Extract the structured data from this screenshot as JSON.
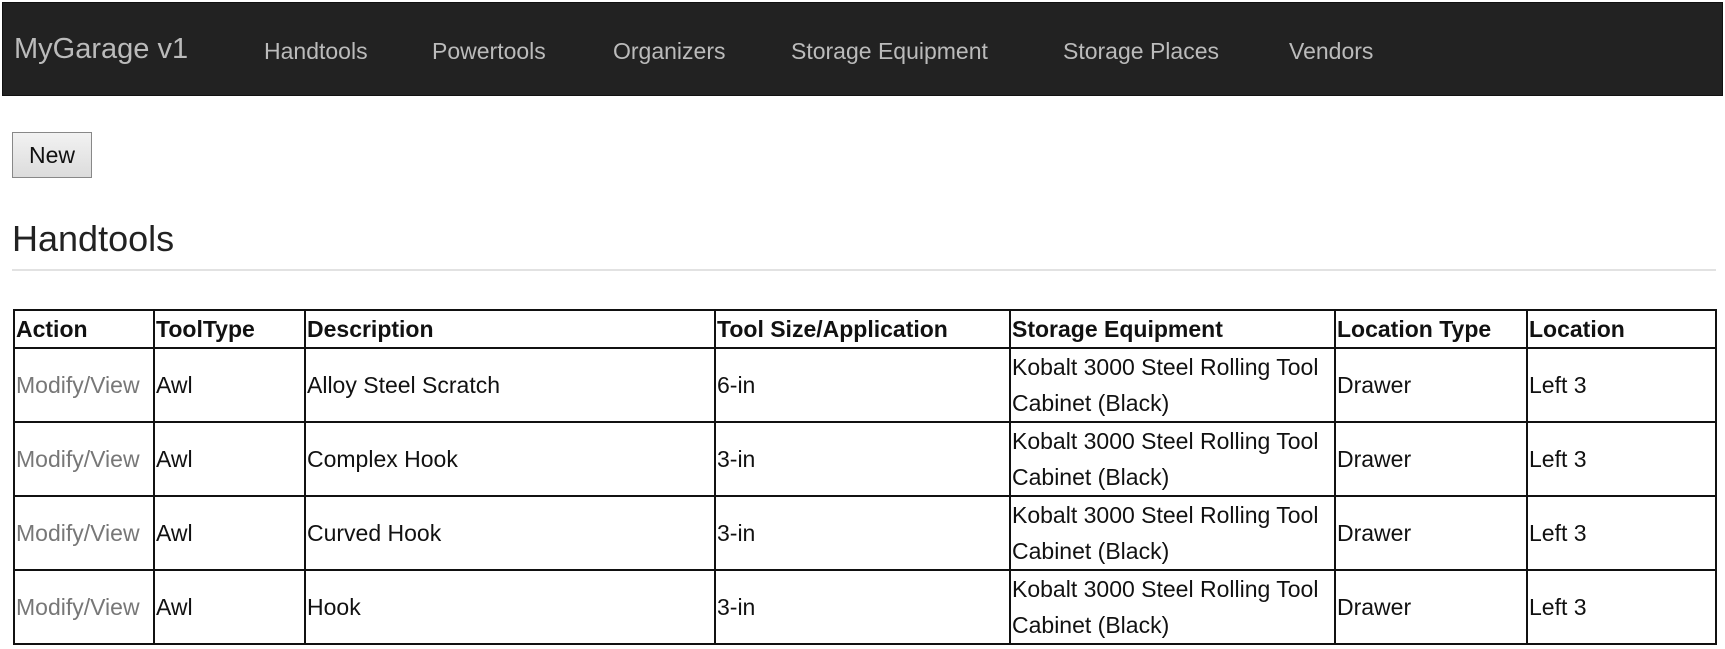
{
  "navbar": {
    "brand": "MyGarage v1",
    "items": [
      "Handtools",
      "Powertools",
      "Organizers",
      "Storage Equipment",
      "Storage Places",
      "Vendors"
    ]
  },
  "new_button": "New",
  "page_title": "Handtools",
  "table": {
    "headers": [
      "Action",
      "ToolType",
      "Description",
      "Tool Size/Application",
      "Storage Equipment",
      "Location Type",
      "Location"
    ],
    "rows": [
      {
        "action": "Modify/View",
        "tooltype": "Awl",
        "description": "Alloy Steel Scratch",
        "size": "6-in",
        "storage": "Kobalt 3000 Steel Rolling Tool Cabinet (Black)",
        "location_type": "Drawer",
        "location": "Left 3"
      },
      {
        "action": "Modify/View",
        "tooltype": "Awl",
        "description": "Complex Hook",
        "size": "3-in",
        "storage": "Kobalt 3000 Steel Rolling Tool Cabinet (Black)",
        "location_type": "Drawer",
        "location": "Left 3"
      },
      {
        "action": "Modify/View",
        "tooltype": "Awl",
        "description": "Curved Hook",
        "size": "3-in",
        "storage": "Kobalt 3000 Steel Rolling Tool Cabinet (Black)",
        "location_type": "Drawer",
        "location": "Left 3"
      },
      {
        "action": "Modify/View",
        "tooltype": "Awl",
        "description": "Hook",
        "size": "3-in",
        "storage": "Kobalt 3000 Steel Rolling Tool Cabinet (Black)",
        "location_type": "Drawer",
        "location": "Left 3"
      }
    ]
  }
}
